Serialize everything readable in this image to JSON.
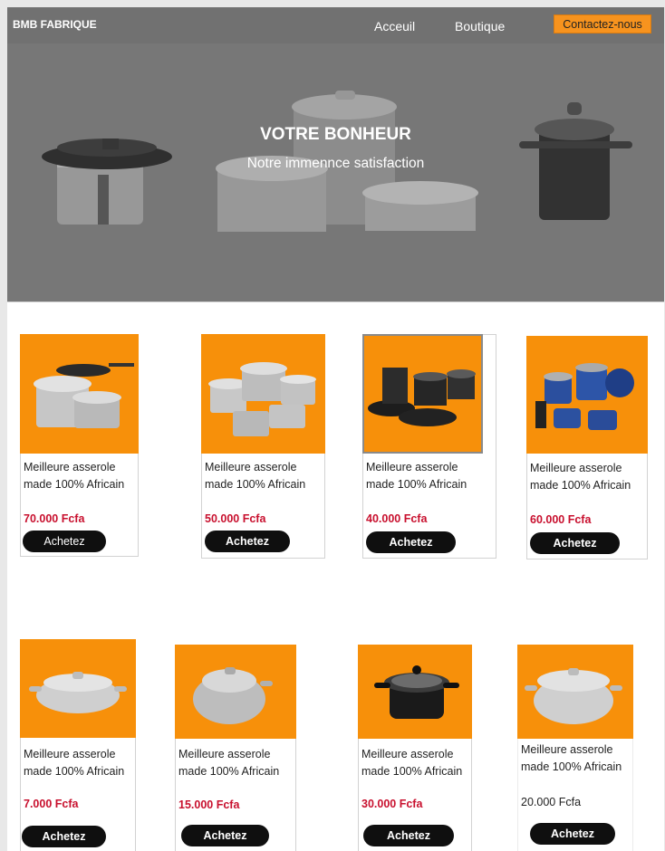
{
  "nav": {
    "brand": "BMB FABRIQUE",
    "links": [
      "Acceuil",
      "Boutique"
    ],
    "contact": "Contactez-nous"
  },
  "hero": {
    "title": "VOTRE BONHEUR",
    "subtitle": "Notre immennce satisfaction"
  },
  "colors": {
    "accent": "#f7931e",
    "price": "#c8102e",
    "button": "#0f0f0f",
    "hero_bg": "#777777"
  },
  "products": [
    {
      "description": "Meilleure asserole made 100% Africain",
      "price": "70.000 Fcfa",
      "button": "Achetez",
      "image": "cookware-set-icon"
    },
    {
      "description": "Meilleure asserole made 100% Africain",
      "price": "50.000 Fcfa",
      "button": "Achetez",
      "image": "cookware-set-icon"
    },
    {
      "description": "Meilleure asserole made 100% Africain",
      "price": "40.000 Fcfa",
      "button": "Achetez",
      "image": "cookware-set-icon"
    },
    {
      "description": "Meilleure asserole made 100% Africain",
      "price": "60.000 Fcfa",
      "button": "Achetez",
      "image": "cookware-set-icon"
    },
    {
      "description": "Meilleure asserole made 100% Africain",
      "price": "7.000 Fcfa",
      "button": "Achetez",
      "image": "aluminium-pot-icon"
    },
    {
      "description": "Meilleure asserole made 100% Africain",
      "price": "15.000 Fcfa",
      "button": "Achetez",
      "image": "aluminium-pot-icon"
    },
    {
      "description": "Meilleure asserole made 100% Africain",
      "price": "30.000 Fcfa",
      "button": "Achetez",
      "image": "black-pot-icon"
    },
    {
      "description": "Meilleure asserole made 100% Africain",
      "price": "20.000 Fcfa",
      "button": "Achetez",
      "image": "aluminium-pot-icon"
    }
  ]
}
